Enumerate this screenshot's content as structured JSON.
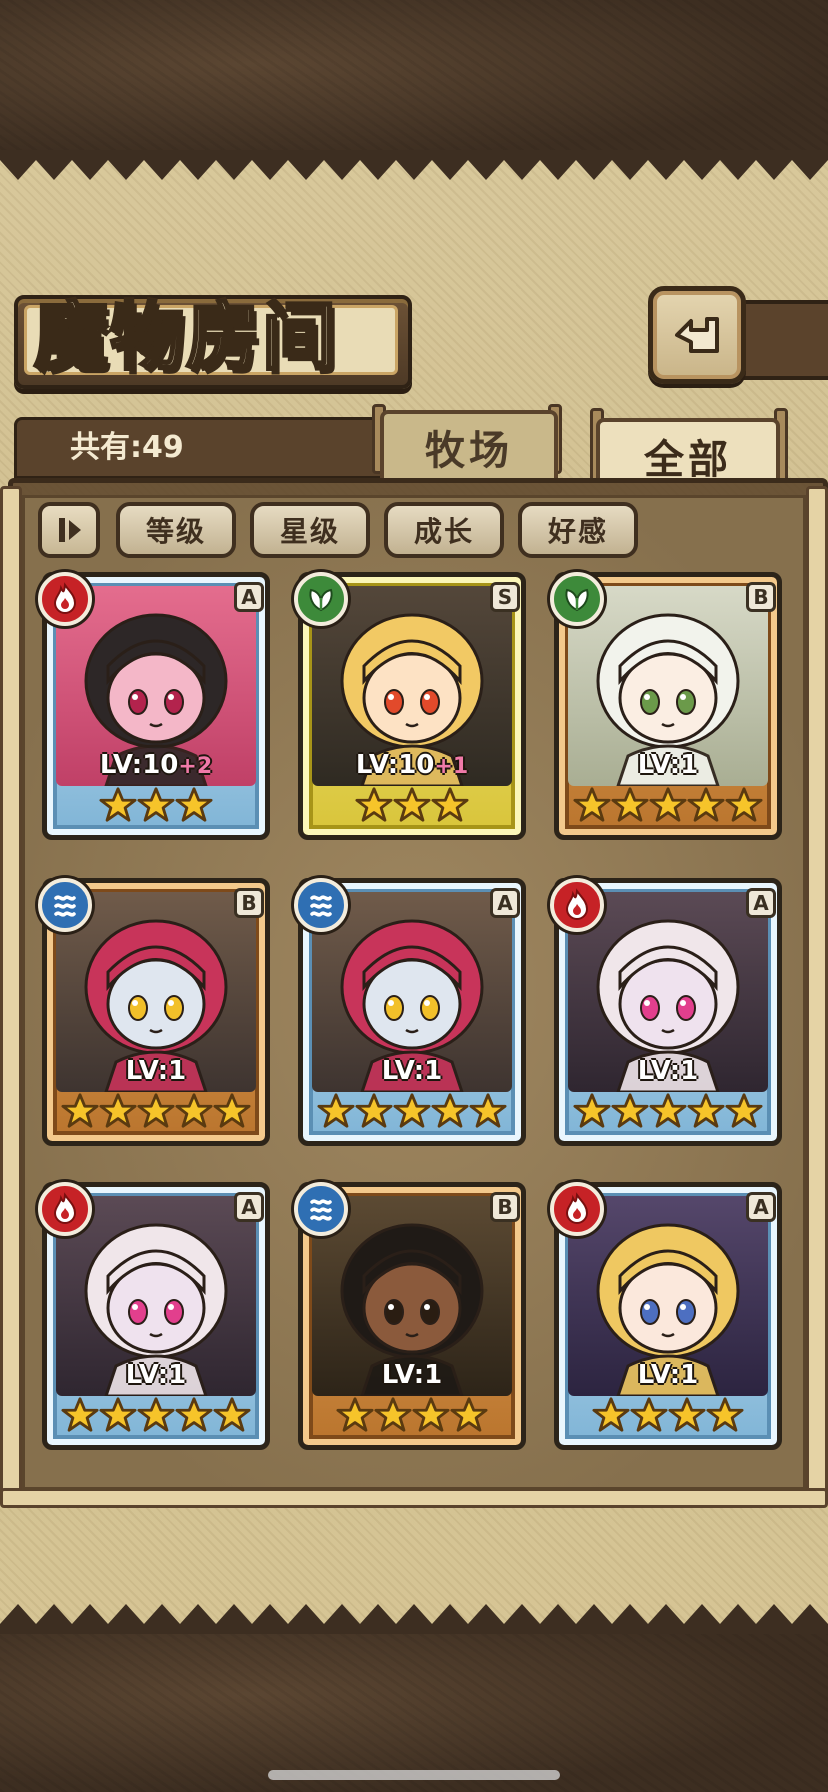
{
  "header": {
    "title": "魔物房间",
    "back_icon": "back-return-icon"
  },
  "info": {
    "count_label": "共有:49"
  },
  "tabs": [
    {
      "label": "牧场",
      "selected": false
    },
    {
      "label": "全部",
      "selected": true
    }
  ],
  "sort": {
    "toggle_icon": "sort-order-icon",
    "buttons": [
      "等级",
      "星级",
      "成长",
      "好感"
    ]
  },
  "monsters": [
    {
      "element": "fire",
      "rank": "A",
      "frame": "blue",
      "level": "LV:10",
      "plus": "+2",
      "stars": 3,
      "art": "pink"
    },
    {
      "element": "leaf",
      "rank": "S",
      "frame": "gold",
      "level": "LV:10",
      "plus": "+1",
      "stars": 3,
      "art": "bee"
    },
    {
      "element": "leaf",
      "rank": "B",
      "frame": "bronze",
      "level": "LV:1",
      "plus": "",
      "stars": 5,
      "art": "white"
    },
    {
      "element": "water",
      "rank": "B",
      "frame": "bronze",
      "level": "LV:1",
      "plus": "",
      "stars": 5,
      "art": "redhair"
    },
    {
      "element": "water",
      "rank": "A",
      "frame": "blue",
      "level": "LV:1",
      "plus": "",
      "stars": 5,
      "art": "redhair"
    },
    {
      "element": "fire",
      "rank": "A",
      "frame": "blue",
      "level": "LV:1",
      "plus": "",
      "stars": 5,
      "art": "ram"
    },
    {
      "element": "fire",
      "rank": "A",
      "frame": "blue",
      "level": "LV:1",
      "plus": "",
      "stars": 5,
      "art": "ram"
    },
    {
      "element": "water",
      "rank": "B",
      "frame": "bronze",
      "level": "LV:1",
      "plus": "",
      "stars": 4,
      "art": "egypt"
    },
    {
      "element": "fire",
      "rank": "A",
      "frame": "blue",
      "level": "LV:1",
      "plus": "",
      "stars": 4,
      "art": "blonde"
    }
  ],
  "colors": {
    "fire": "#c62226",
    "leaf": "#3d8a3a",
    "water": "#2f6fb3",
    "star": "#f6c42a"
  }
}
